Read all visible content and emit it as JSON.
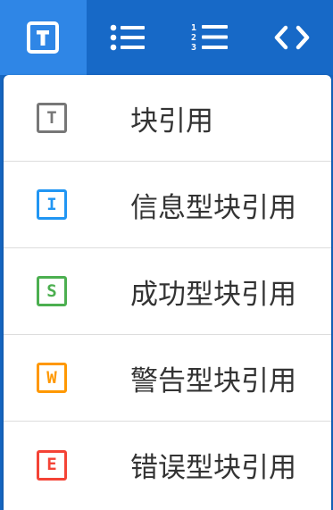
{
  "toolbar": {
    "buttons": [
      {
        "icon": "text-block-icon",
        "active": true
      },
      {
        "icon": "bulleted-list-icon",
        "active": false
      },
      {
        "icon": "numbered-list-icon",
        "active": false
      },
      {
        "icon": "code-icon",
        "active": false
      }
    ],
    "numbered_list_digits": [
      "1",
      "2",
      "3"
    ]
  },
  "menu": {
    "items": [
      {
        "letter": "T",
        "label": "块引用",
        "color": "#777777"
      },
      {
        "letter": "I",
        "label": "信息型块引用",
        "color": "#2196f3"
      },
      {
        "letter": "S",
        "label": "成功型块引用",
        "color": "#4caf50"
      },
      {
        "letter": "W",
        "label": "警告型块引用",
        "color": "#ff9800"
      },
      {
        "letter": "E",
        "label": "错误型块引用",
        "color": "#f44336"
      }
    ]
  }
}
